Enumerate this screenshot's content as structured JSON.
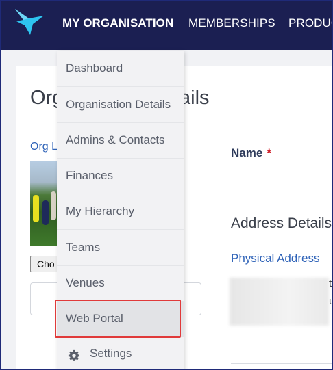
{
  "nav": {
    "items": [
      {
        "label": "MY ORGANISATION"
      },
      {
        "label": "MEMBERSHIPS"
      },
      {
        "label": "PRODUC"
      }
    ]
  },
  "page": {
    "title_left": "Org",
    "title_right": "ails",
    "org_logo_label": "Org L",
    "choose_button": "Cho",
    "name_label": "Name",
    "required_mark": "*",
    "address_title": "Address Details",
    "physical_label": "Physical Address",
    "partial_text_1": "t",
    "partial_text_2": "u"
  },
  "dropdown": {
    "items": [
      {
        "label": "Dashboard"
      },
      {
        "label": "Organisation Details"
      },
      {
        "label": "Admins & Contacts"
      },
      {
        "label": "Finances"
      },
      {
        "label": "My Hierarchy"
      },
      {
        "label": "Teams"
      },
      {
        "label": "Venues"
      },
      {
        "label": "Web Portal"
      },
      {
        "label": "Settings",
        "icon": "gear-icon"
      }
    ],
    "selected": "Web Portal"
  },
  "colors": {
    "nav_bg": "#1b1f52",
    "logo_accent": "#2ec4f0",
    "highlight": "#e03a3a",
    "link_blue": "#2f63b8",
    "required": "#d0202a"
  }
}
